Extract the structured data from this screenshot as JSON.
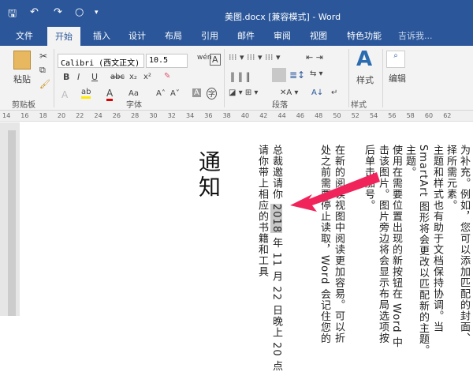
{
  "window": {
    "title": "美图.docx [兼容模式] - Word"
  },
  "quick_access": {
    "save": "🖫",
    "undo": "↶",
    "redo": "↷",
    "circle": "○",
    "more": "▾"
  },
  "tabs": [
    "文件",
    "开始",
    "插入",
    "设计",
    "布局",
    "引用",
    "邮件",
    "审阅",
    "视图",
    "特色功能"
  ],
  "tell_me": "吉诉我...",
  "ribbon": {
    "paste": "粘贴",
    "font_name": "Calibri (西文正文)",
    "font_size": "10.5",
    "bold": "B",
    "italic": "I",
    "underline": "U",
    "strike": "abc",
    "sub": "x₂",
    "sup": "x²",
    "text_effect": "A",
    "highlight": "ab",
    "font_color": "A",
    "case": "Aa",
    "grow": "A˄",
    "shrink": "A˅",
    "char_shade": "A",
    "enclose": "字",
    "styles": "样式",
    "editing": "编辑",
    "groups": [
      "剪贴板",
      "字体",
      "段落",
      "样式"
    ]
  },
  "ruler": [
    "14",
    "16",
    "18",
    "20",
    "22",
    "24",
    "26",
    "28",
    "30",
    "32",
    "34",
    "36",
    "38",
    "40",
    "42",
    "44",
    "46",
    "48",
    "50",
    "52",
    "54",
    "56",
    "58",
    "60",
    "62"
  ],
  "document": {
    "heading": "通知",
    "columns": [
      "为补充。例如，您可以添加匹配的封面、",
      "择所需元素。",
      "主题和样式也有助于文档保持协调。当",
      "SmartArt 图形将会更改以匹配新的主题。",
      "主题。",
      "使用在需要位置出现的新按钮在 Word 中",
      "击该图片。图片旁边将会显示布局选项按",
      "后单击加号。",
      "在新的阅读视图中阅读更加容易。可以折",
      "处之前需要停止读取，Word 会记住您的"
    ],
    "line1_pre": "总裁邀请你 ",
    "line1_year": "2018",
    "line1_post": " 年 11 月 22 日晚上 20 点",
    "line2": "请你带上相应的书籍和工具"
  },
  "colors": {
    "brand": "#2b579a",
    "arrow": "#f0245a"
  }
}
